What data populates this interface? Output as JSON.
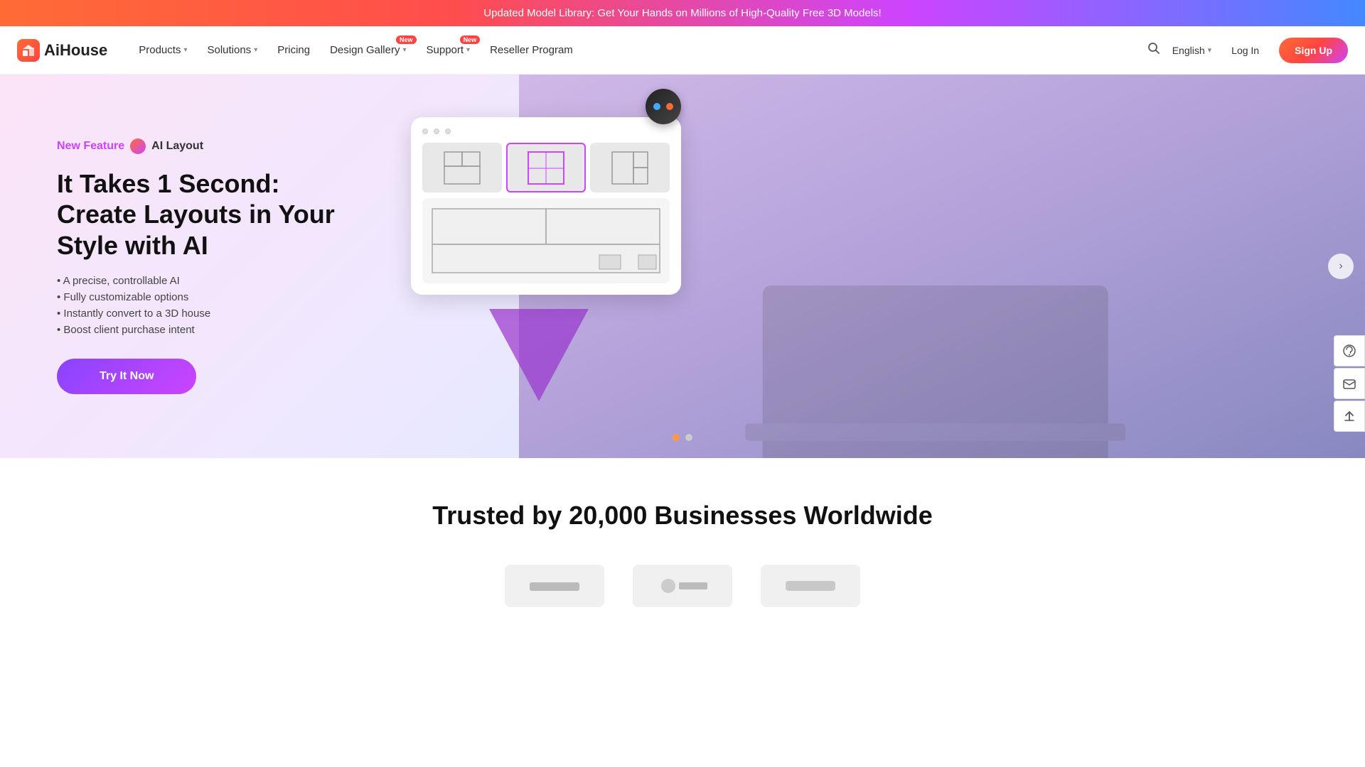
{
  "banner": {
    "text": "Updated Model Library: Get Your Hands on Millions of High-Quality Free 3D Models!"
  },
  "navbar": {
    "logo_text": "AiHouse",
    "nav_items": [
      {
        "id": "products",
        "label": "Products",
        "has_dropdown": true,
        "badge": null
      },
      {
        "id": "solutions",
        "label": "Solutions",
        "has_dropdown": true,
        "badge": null
      },
      {
        "id": "pricing",
        "label": "Pricing",
        "has_dropdown": false,
        "badge": null
      },
      {
        "id": "design-gallery",
        "label": "Design Gallery",
        "has_dropdown": true,
        "badge": "New"
      },
      {
        "id": "support",
        "label": "Support",
        "has_dropdown": true,
        "badge": "New"
      },
      {
        "id": "reseller-program",
        "label": "Reseller Program",
        "has_dropdown": false,
        "badge": null
      }
    ],
    "search_label": "Search",
    "language": "English",
    "login_label": "Log In",
    "signup_label": "Sign Up"
  },
  "hero": {
    "feature_label": "New Feature",
    "ai_layout_label": "AI Layout",
    "title": "It Takes 1 Second: Create Layouts in Your Style with AI",
    "bullets": [
      "A precise, controllable AI",
      "Fully customizable options",
      "Instantly convert to a 3D house",
      "Boost client purchase intent"
    ],
    "cta_label": "Try It Now",
    "carousel_dots": [
      {
        "active": true
      },
      {
        "active": false
      }
    ],
    "prev_arrow": "‹",
    "next_arrow": "›"
  },
  "trusted": {
    "title": "Trusted by 20,000 Businesses Worldwide"
  },
  "side_buttons": [
    {
      "id": "support-icon",
      "icon": "🎧"
    },
    {
      "id": "mail-icon",
      "icon": "✉"
    },
    {
      "id": "top-icon",
      "icon": "⬆"
    }
  ]
}
